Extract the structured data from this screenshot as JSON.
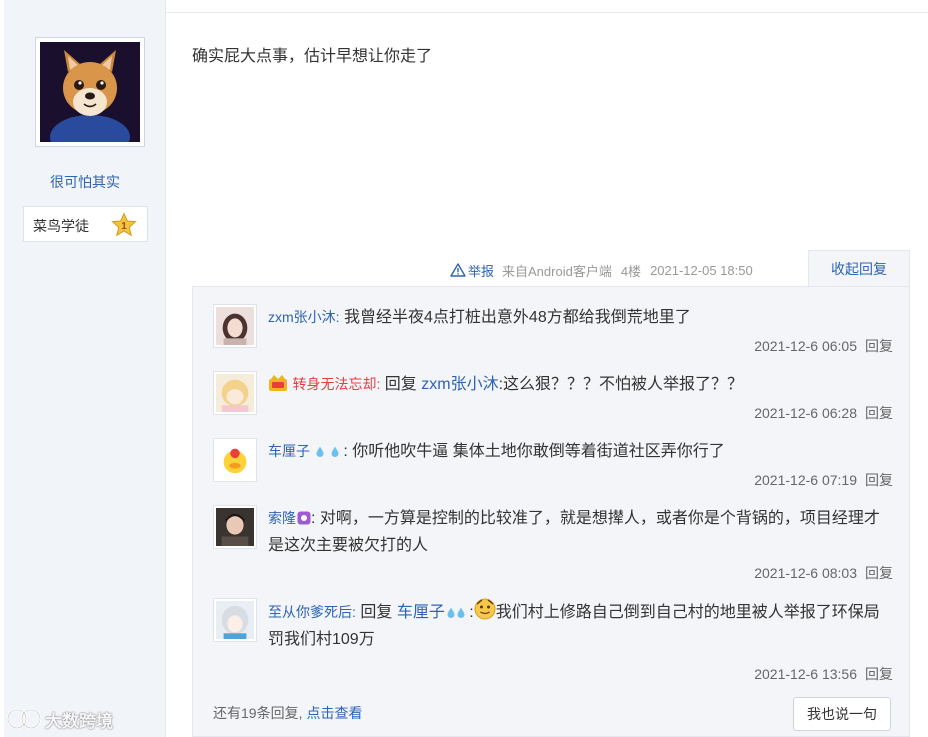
{
  "post": {
    "author": {
      "name": "很可怕其实",
      "level_name": "菜鸟学徒",
      "level_number": "1"
    },
    "content": "确实屁大点事，估计早想让你走了",
    "meta": {
      "report_label": "举报",
      "source": "来自Android客户端",
      "floor": "4楼",
      "time": "2021-12-05 18:50"
    },
    "collapse_label": "收起回复"
  },
  "replies": [
    {
      "user": "zxm张小沐:",
      "text": "我曾经半夜4点打桩出意外48方都给我倒荒地里了",
      "time": "2021-12-6 06:05",
      "reply_label": "回复"
    },
    {
      "user": "转身无法忘却:",
      "prefix": "回复",
      "mention": "zxm张小沐",
      "text": ":这么狠？？？不怕被人举报了？？",
      "time": "2021-12-6 06:28",
      "reply_label": "回复"
    },
    {
      "user": "车厘子",
      "user_suffix": ":",
      "text": "你听他吹牛逼 集体土地你敢倒等着街道社区弄你行了",
      "time": "2021-12-6 07:19",
      "reply_label": "回复"
    },
    {
      "user": "索隆",
      "user_suffix": ":",
      "text": "对啊，一方算是控制的比较准了，就是想撵人，或者你是个背锅的，项目经理才是这次主要被欠打的人",
      "time": "2021-12-6 08:03",
      "reply_label": "回复"
    },
    {
      "user": "至从你爹死后:",
      "prefix": "回复",
      "mention": "车厘子",
      "separator": ":",
      "text": "我们村上修路自己倒到自己村的地里被人举报了环保局罚我们村109万",
      "time": "2021-12-6 13:56",
      "reply_label": "回复"
    }
  ],
  "footer": {
    "more_text": "还有19条回复,",
    "more_link": "点击查看",
    "say_button": "我也说一句"
  },
  "watermark": "大数跨境",
  "colors": {
    "link": "#2d64b3",
    "panel_bg": "#f3f5f9",
    "sidebar_bg": "#f1f4f9",
    "red_name": "#e23f3f"
  }
}
